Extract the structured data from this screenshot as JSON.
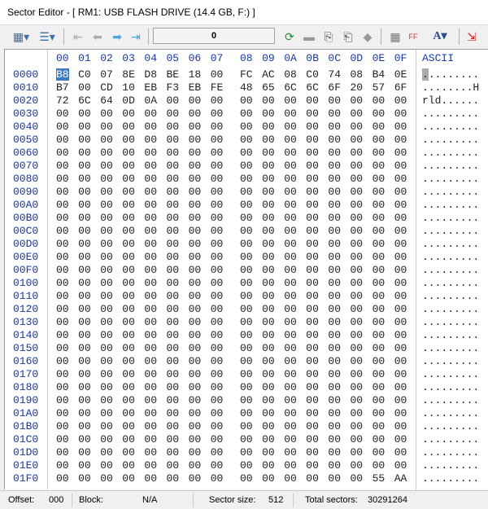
{
  "window": {
    "title": "Sector Editor - [ RM1:  USB FLASH DRIVE (14.4 GB, F:) ]"
  },
  "toolbar": {
    "position_value": "0",
    "icons": [
      "view-mode-icon",
      "layout-icon",
      "first-sector-icon",
      "previous-sector-icon",
      "next-sector-icon",
      "last-sector-icon",
      "refresh-icon",
      "save-icon",
      "copy-icon",
      "paste-icon",
      "fill-icon",
      "calculator-icon",
      "hex-decimal-icon",
      "font-icon",
      "exit-icon"
    ]
  },
  "grid": {
    "header_columns": [
      "00",
      "01",
      "02",
      "03",
      "04",
      "05",
      "06",
      "07",
      "08",
      "09",
      "0A",
      "0B",
      "0C",
      "0D",
      "0E",
      "0F"
    ],
    "ascii_header": "ASCII",
    "selected_byte": {
      "row": 0,
      "col": 0
    },
    "rows": [
      {
        "offset": "0000",
        "bytes": "B8 C0 07 8E D8 BE 18 00 FC AC 08 C0 74 08 B4 0E",
        "ascii": "........."
      },
      {
        "offset": "0010",
        "bytes": "B7 00 CD 10 EB F3 EB FE 48 65 6C 6C 6F 20 57 6F",
        "ascii": "........H"
      },
      {
        "offset": "0020",
        "bytes": "72 6C 64 0D 0A 00 00 00 00 00 00 00 00 00 00 00",
        "ascii": "rld......"
      },
      {
        "offset": "0030",
        "bytes": "00 00 00 00 00 00 00 00 00 00 00 00 00 00 00 00",
        "ascii": "........."
      },
      {
        "offset": "0040",
        "bytes": "00 00 00 00 00 00 00 00 00 00 00 00 00 00 00 00",
        "ascii": "........."
      },
      {
        "offset": "0050",
        "bytes": "00 00 00 00 00 00 00 00 00 00 00 00 00 00 00 00",
        "ascii": "........."
      },
      {
        "offset": "0060",
        "bytes": "00 00 00 00 00 00 00 00 00 00 00 00 00 00 00 00",
        "ascii": "........."
      },
      {
        "offset": "0070",
        "bytes": "00 00 00 00 00 00 00 00 00 00 00 00 00 00 00 00",
        "ascii": "........."
      },
      {
        "offset": "0080",
        "bytes": "00 00 00 00 00 00 00 00 00 00 00 00 00 00 00 00",
        "ascii": "........."
      },
      {
        "offset": "0090",
        "bytes": "00 00 00 00 00 00 00 00 00 00 00 00 00 00 00 00",
        "ascii": "........."
      },
      {
        "offset": "00A0",
        "bytes": "00 00 00 00 00 00 00 00 00 00 00 00 00 00 00 00",
        "ascii": "........."
      },
      {
        "offset": "00B0",
        "bytes": "00 00 00 00 00 00 00 00 00 00 00 00 00 00 00 00",
        "ascii": "........."
      },
      {
        "offset": "00C0",
        "bytes": "00 00 00 00 00 00 00 00 00 00 00 00 00 00 00 00",
        "ascii": "........."
      },
      {
        "offset": "00D0",
        "bytes": "00 00 00 00 00 00 00 00 00 00 00 00 00 00 00 00",
        "ascii": "........."
      },
      {
        "offset": "00E0",
        "bytes": "00 00 00 00 00 00 00 00 00 00 00 00 00 00 00 00",
        "ascii": "........."
      },
      {
        "offset": "00F0",
        "bytes": "00 00 00 00 00 00 00 00 00 00 00 00 00 00 00 00",
        "ascii": "........."
      },
      {
        "offset": "0100",
        "bytes": "00 00 00 00 00 00 00 00 00 00 00 00 00 00 00 00",
        "ascii": "........."
      },
      {
        "offset": "0110",
        "bytes": "00 00 00 00 00 00 00 00 00 00 00 00 00 00 00 00",
        "ascii": "........."
      },
      {
        "offset": "0120",
        "bytes": "00 00 00 00 00 00 00 00 00 00 00 00 00 00 00 00",
        "ascii": "........."
      },
      {
        "offset": "0130",
        "bytes": "00 00 00 00 00 00 00 00 00 00 00 00 00 00 00 00",
        "ascii": "........."
      },
      {
        "offset": "0140",
        "bytes": "00 00 00 00 00 00 00 00 00 00 00 00 00 00 00 00",
        "ascii": "........."
      },
      {
        "offset": "0150",
        "bytes": "00 00 00 00 00 00 00 00 00 00 00 00 00 00 00 00",
        "ascii": "........."
      },
      {
        "offset": "0160",
        "bytes": "00 00 00 00 00 00 00 00 00 00 00 00 00 00 00 00",
        "ascii": "........."
      },
      {
        "offset": "0170",
        "bytes": "00 00 00 00 00 00 00 00 00 00 00 00 00 00 00 00",
        "ascii": "........."
      },
      {
        "offset": "0180",
        "bytes": "00 00 00 00 00 00 00 00 00 00 00 00 00 00 00 00",
        "ascii": "........."
      },
      {
        "offset": "0190",
        "bytes": "00 00 00 00 00 00 00 00 00 00 00 00 00 00 00 00",
        "ascii": "........."
      },
      {
        "offset": "01A0",
        "bytes": "00 00 00 00 00 00 00 00 00 00 00 00 00 00 00 00",
        "ascii": "........."
      },
      {
        "offset": "01B0",
        "bytes": "00 00 00 00 00 00 00 00 00 00 00 00 00 00 00 00",
        "ascii": "........."
      },
      {
        "offset": "01C0",
        "bytes": "00 00 00 00 00 00 00 00 00 00 00 00 00 00 00 00",
        "ascii": "........."
      },
      {
        "offset": "01D0",
        "bytes": "00 00 00 00 00 00 00 00 00 00 00 00 00 00 00 00",
        "ascii": "........."
      },
      {
        "offset": "01E0",
        "bytes": "00 00 00 00 00 00 00 00 00 00 00 00 00 00 00 00",
        "ascii": "........."
      },
      {
        "offset": "01F0",
        "bytes": "00 00 00 00 00 00 00 00 00 00 00 00 00 00 55 AA",
        "ascii": "........."
      }
    ]
  },
  "status": {
    "offset_label": "Offset:",
    "offset_value": "000",
    "block_label": "Block:",
    "block_value": "N/A",
    "sector_size_label": "Sector size:",
    "sector_size_value": "512",
    "total_sectors_label": "Total sectors:",
    "total_sectors_value": "30291264"
  }
}
